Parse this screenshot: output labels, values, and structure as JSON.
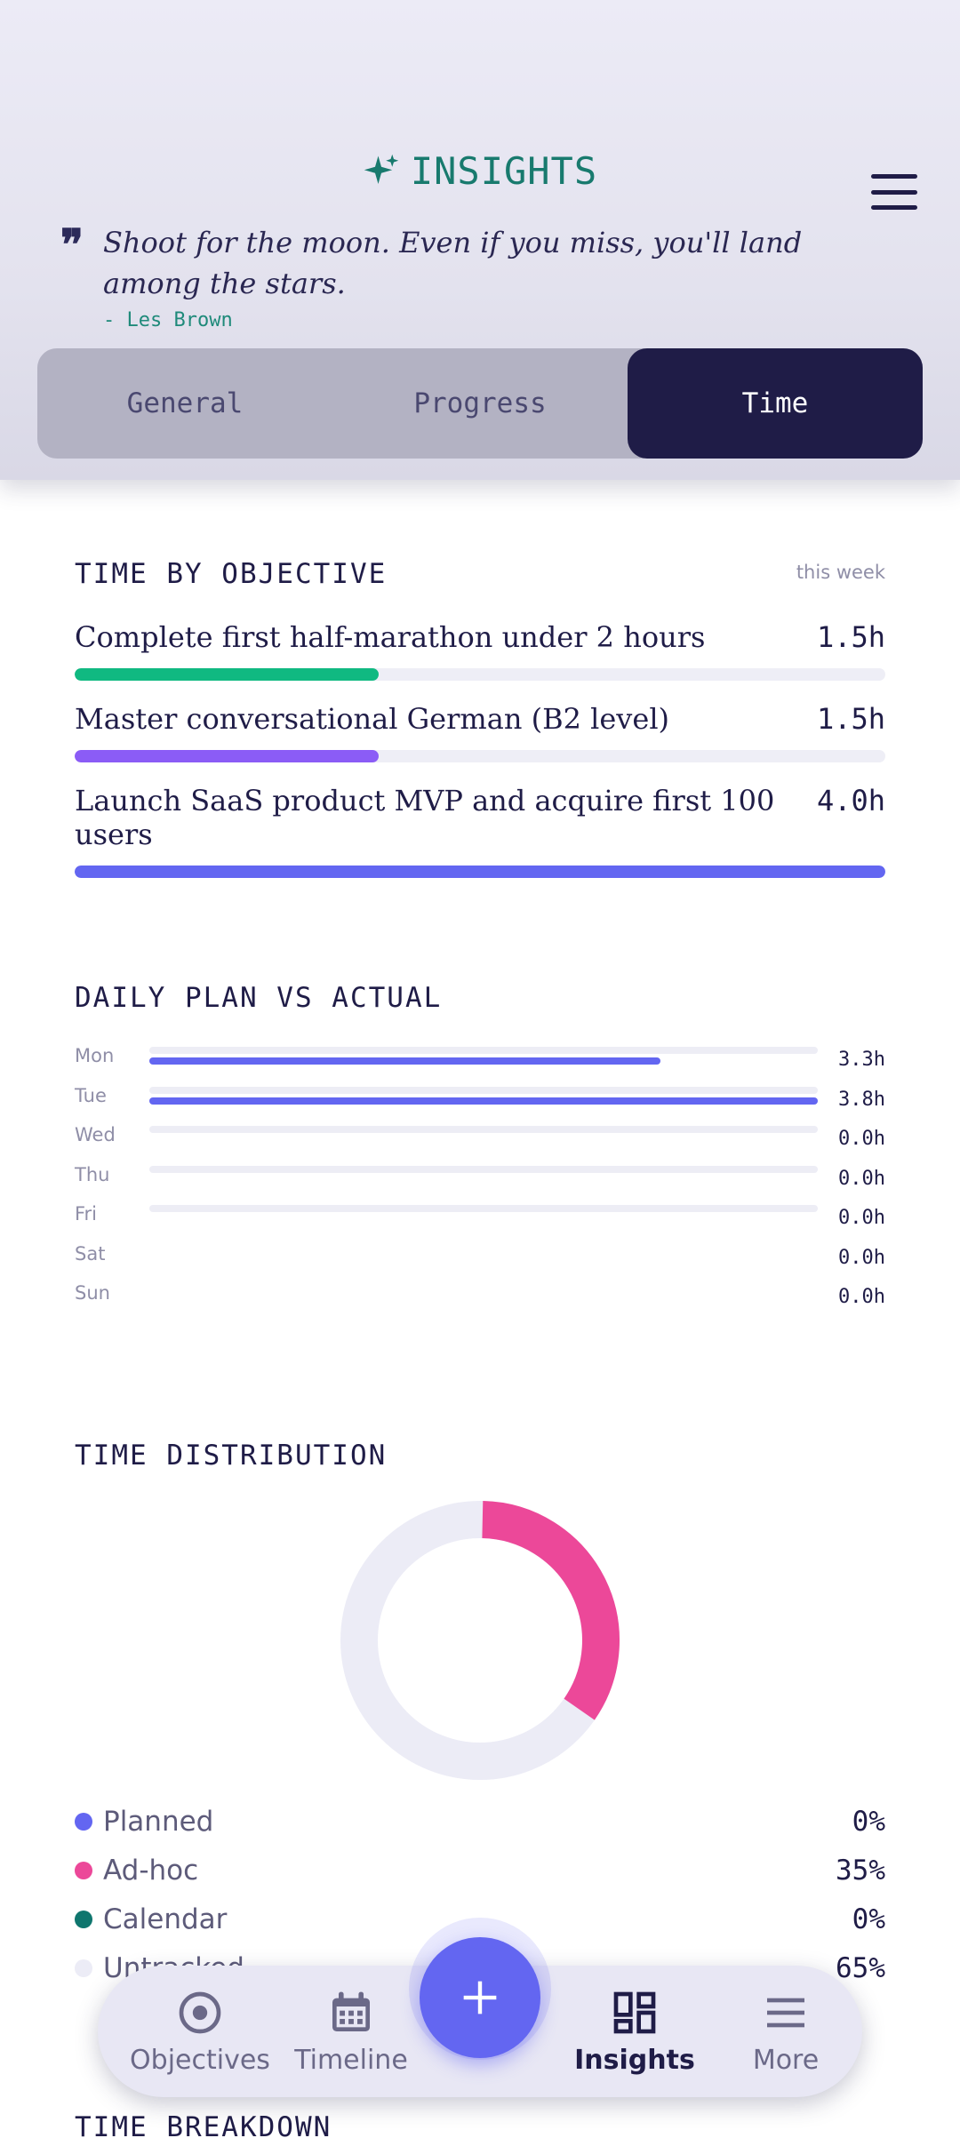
{
  "header": {
    "title": "INSIGHTS",
    "quote": "Shoot for the moon. Even if you miss, you'll land among the stars.",
    "author": "- Les Brown",
    "tabs": [
      {
        "label": "General",
        "active": false
      },
      {
        "label": "Progress",
        "active": false
      },
      {
        "label": "Time",
        "active": true
      }
    ]
  },
  "time_by_objective": {
    "title": "TIME BY OBJECTIVE",
    "period": "this week",
    "items": [
      {
        "name": "Complete first half-marathon under 2 hours",
        "hours": "1.5h",
        "fraction": 0.375,
        "color": "#10b981"
      },
      {
        "name": "Master conversational German (B2 level)",
        "hours": "1.5h",
        "fraction": 0.375,
        "color": "#8b5cf6"
      },
      {
        "name": "Launch SaaS product MVP and acquire first 100 users",
        "hours": "4.0h",
        "fraction": 1.0,
        "color": "#6366f1"
      }
    ]
  },
  "daily_plan": {
    "title": "DAILY PLAN VS ACTUAL",
    "days": [
      {
        "day": "Mon",
        "value": "3.3h",
        "fraction": 0.764,
        "has_track": true
      },
      {
        "day": "Tue",
        "value": "3.8h",
        "fraction": 1.0,
        "has_track": true
      },
      {
        "day": "Wed",
        "value": "0.0h",
        "fraction": 0,
        "has_track": true
      },
      {
        "day": "Thu",
        "value": "0.0h",
        "fraction": 0,
        "has_track": true
      },
      {
        "day": "Fri",
        "value": "0.0h",
        "fraction": 0,
        "has_track": true
      },
      {
        "day": "Sat",
        "value": "0.0h",
        "fraction": 0,
        "has_track": false
      },
      {
        "day": "Sun",
        "value": "0.0h",
        "fraction": 0,
        "has_track": false
      }
    ]
  },
  "time_distribution": {
    "title": "TIME DISTRIBUTION",
    "items": [
      {
        "label": "Planned",
        "value": "0%",
        "percent": 0,
        "color": "#6366f1"
      },
      {
        "label": "Ad-hoc",
        "value": "35%",
        "percent": 35,
        "color": "#ec4899"
      },
      {
        "label": "Calendar",
        "value": "0%",
        "percent": 0,
        "color": "#0f766e"
      },
      {
        "label": "Untracked",
        "value": "65%",
        "percent": 65,
        "color": "#ececf6"
      }
    ]
  },
  "time_breakdown": {
    "title": "TIME BREAKDOWN"
  },
  "nav": {
    "items": [
      {
        "label": "Objectives",
        "icon": "target-icon",
        "active": false
      },
      {
        "label": "Timeline",
        "icon": "calendar-icon",
        "active": false
      },
      {
        "label": "Insights",
        "icon": "dashboard-icon",
        "active": true
      },
      {
        "label": "More",
        "icon": "menu-icon",
        "active": false
      }
    ],
    "fab_icon": "plus-icon"
  }
}
